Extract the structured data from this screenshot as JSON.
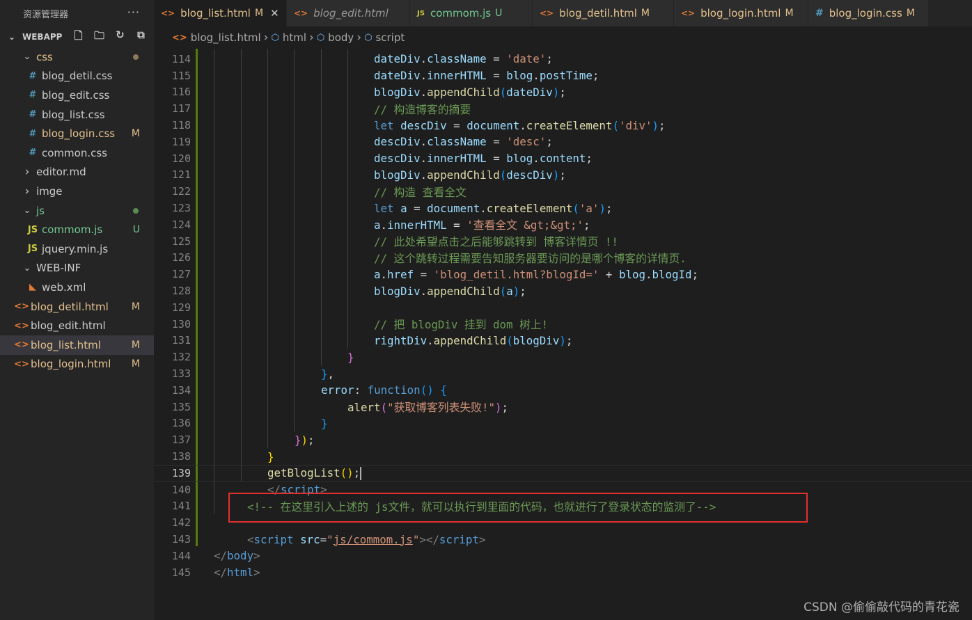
{
  "sidebar": {
    "title": "资源管理器",
    "more": "···",
    "section": "WEBAPP",
    "tree": [
      {
        "label": "css",
        "kind": "folder-open",
        "depth": 1,
        "status": "",
        "dot": "#8a7a5a",
        "color": "#e2c08d"
      },
      {
        "label": "blog_detil.css",
        "kind": "css",
        "depth": 2,
        "status": ""
      },
      {
        "label": "blog_edit.css",
        "kind": "css",
        "depth": 2,
        "status": ""
      },
      {
        "label": "blog_list.css",
        "kind": "css",
        "depth": 2,
        "status": ""
      },
      {
        "label": "blog_login.css",
        "kind": "css",
        "depth": 2,
        "status": "M",
        "color": "#e2c08d"
      },
      {
        "label": "common.css",
        "kind": "css",
        "depth": 2,
        "status": ""
      },
      {
        "label": "editor.md",
        "kind": "folder-closed",
        "depth": 1,
        "status": ""
      },
      {
        "label": "imge",
        "kind": "folder-closed",
        "depth": 1,
        "status": ""
      },
      {
        "label": "js",
        "kind": "folder-open",
        "depth": 1,
        "status": "",
        "dot": "#5e8a56",
        "color": "#73c991"
      },
      {
        "label": "commom.js",
        "kind": "js",
        "depth": 2,
        "status": "U",
        "color": "#73c991"
      },
      {
        "label": "jquery.min.js",
        "kind": "js",
        "depth": 2,
        "status": ""
      },
      {
        "label": "WEB-INF",
        "kind": "folder-open",
        "depth": 1,
        "status": ""
      },
      {
        "label": "web.xml",
        "kind": "xml",
        "depth": 2,
        "status": ""
      },
      {
        "label": "blog_detil.html",
        "kind": "html",
        "depth": 1,
        "status": "M",
        "color": "#e2c08d"
      },
      {
        "label": "blog_edit.html",
        "kind": "html",
        "depth": 1,
        "status": ""
      },
      {
        "label": "blog_list.html",
        "kind": "html",
        "depth": 1,
        "status": "M",
        "color": "#e2c08d",
        "selected": true
      },
      {
        "label": "blog_login.html",
        "kind": "html",
        "depth": 1,
        "status": "M",
        "color": "#e2c08d"
      }
    ]
  },
  "tabs": [
    {
      "label": "blog_list.html",
      "icon": "html",
      "status": "M",
      "active": true,
      "close": "✕"
    },
    {
      "label": "blog_edit.html",
      "icon": "html",
      "status": "",
      "italic": true
    },
    {
      "label": "commom.js",
      "icon": "js",
      "status": "U"
    },
    {
      "label": "blog_detil.html",
      "icon": "html",
      "status": "M"
    },
    {
      "label": "blog_login.html",
      "icon": "html",
      "status": "M"
    },
    {
      "label": "blog_login.css",
      "icon": "css",
      "status": "M"
    }
  ],
  "breadcrumb": [
    "blog_list.html",
    "html",
    "body",
    "script"
  ],
  "editor": {
    "current_line": 139,
    "lines": [
      {
        "n": 114,
        "i": 6,
        "t": [
          [
            "var",
            "dateDiv"
          ],
          [
            "",
            "."
          ],
          [
            "var",
            "className"
          ],
          [
            "",
            " = "
          ],
          [
            "str",
            "'date'"
          ],
          [
            "",
            ";"
          ]
        ]
      },
      {
        "n": 115,
        "i": 6,
        "t": [
          [
            "var",
            "dateDiv"
          ],
          [
            "",
            "."
          ],
          [
            "var",
            "innerHTML"
          ],
          [
            "",
            " = "
          ],
          [
            "var",
            "blog"
          ],
          [
            "",
            "."
          ],
          [
            "var",
            "postTime"
          ],
          [
            "",
            ";"
          ]
        ]
      },
      {
        "n": 116,
        "i": 6,
        "t": [
          [
            "var",
            "blogDiv"
          ],
          [
            "",
            "."
          ],
          [
            "fn",
            "appendChild"
          ],
          [
            "b3",
            "("
          ],
          [
            "var",
            "dateDiv"
          ],
          [
            "b3",
            ")"
          ],
          [
            "",
            ";"
          ]
        ]
      },
      {
        "n": 117,
        "i": 6,
        "t": [
          [
            "cm",
            "// 构造博客的摘要"
          ]
        ]
      },
      {
        "n": 118,
        "i": 6,
        "t": [
          [
            "kw",
            "let"
          ],
          [
            "",
            " "
          ],
          [
            "var",
            "descDiv"
          ],
          [
            "",
            " = "
          ],
          [
            "var",
            "document"
          ],
          [
            "",
            "."
          ],
          [
            "fn",
            "createElement"
          ],
          [
            "b3",
            "("
          ],
          [
            "str",
            "'div'"
          ],
          [
            "b3",
            ")"
          ],
          [
            "",
            ";"
          ]
        ]
      },
      {
        "n": 119,
        "i": 6,
        "t": [
          [
            "var",
            "descDiv"
          ],
          [
            "",
            "."
          ],
          [
            "var",
            "className"
          ],
          [
            "",
            " = "
          ],
          [
            "str",
            "'desc'"
          ],
          [
            "",
            ";"
          ]
        ]
      },
      {
        "n": 120,
        "i": 6,
        "t": [
          [
            "var",
            "descDiv"
          ],
          [
            "",
            "."
          ],
          [
            "var",
            "innerHTML"
          ],
          [
            "",
            " = "
          ],
          [
            "var",
            "blog"
          ],
          [
            "",
            "."
          ],
          [
            "var",
            "content"
          ],
          [
            "",
            ";"
          ]
        ]
      },
      {
        "n": 121,
        "i": 6,
        "t": [
          [
            "var",
            "blogDiv"
          ],
          [
            "",
            "."
          ],
          [
            "fn",
            "appendChild"
          ],
          [
            "b3",
            "("
          ],
          [
            "var",
            "descDiv"
          ],
          [
            "b3",
            ")"
          ],
          [
            "",
            ";"
          ]
        ]
      },
      {
        "n": 122,
        "i": 6,
        "t": [
          [
            "cm",
            "// 构造 查看全文"
          ]
        ]
      },
      {
        "n": 123,
        "i": 6,
        "t": [
          [
            "kw",
            "let"
          ],
          [
            "",
            " "
          ],
          [
            "var",
            "a"
          ],
          [
            "",
            " = "
          ],
          [
            "var",
            "document"
          ],
          [
            "",
            "."
          ],
          [
            "fn",
            "createElement"
          ],
          [
            "b3",
            "("
          ],
          [
            "str",
            "'a'"
          ],
          [
            "b3",
            ")"
          ],
          [
            "",
            ";"
          ]
        ]
      },
      {
        "n": 124,
        "i": 6,
        "t": [
          [
            "var",
            "a"
          ],
          [
            "",
            "."
          ],
          [
            "var",
            "innerHTML"
          ],
          [
            "",
            " = "
          ],
          [
            "str",
            "'查看全文 &gt;&gt;'"
          ],
          [
            "",
            ";"
          ]
        ]
      },
      {
        "n": 125,
        "i": 6,
        "t": [
          [
            "cm",
            "// 此处希望点击之后能够跳转到 博客详情页 !!"
          ]
        ]
      },
      {
        "n": 126,
        "i": 6,
        "t": [
          [
            "cm",
            "// 这个跳转过程需要告知服务器要访问的是哪个博客的详情页."
          ]
        ]
      },
      {
        "n": 127,
        "i": 6,
        "t": [
          [
            "var",
            "a"
          ],
          [
            "",
            "."
          ],
          [
            "var",
            "href"
          ],
          [
            "",
            " = "
          ],
          [
            "str",
            "'blog_detil.html?blogId='"
          ],
          [
            "",
            " + "
          ],
          [
            "var",
            "blog"
          ],
          [
            "",
            "."
          ],
          [
            "var",
            "blogId"
          ],
          [
            "",
            ";"
          ]
        ]
      },
      {
        "n": 128,
        "i": 6,
        "t": [
          [
            "var",
            "blogDiv"
          ],
          [
            "",
            "."
          ],
          [
            "fn",
            "appendChild"
          ],
          [
            "b3",
            "("
          ],
          [
            "var",
            "a"
          ],
          [
            "b3",
            ")"
          ],
          [
            "",
            ";"
          ]
        ]
      },
      {
        "n": 129,
        "i": 0,
        "t": []
      },
      {
        "n": 130,
        "i": 6,
        "t": [
          [
            "cm",
            "// 把 blogDiv 挂到 dom 树上!"
          ]
        ]
      },
      {
        "n": 131,
        "i": 6,
        "t": [
          [
            "var",
            "rightDiv"
          ],
          [
            "",
            "."
          ],
          [
            "fn",
            "appendChild"
          ],
          [
            "b3",
            "("
          ],
          [
            "var",
            "blogDiv"
          ],
          [
            "b3",
            ")"
          ],
          [
            "",
            ";"
          ]
        ]
      },
      {
        "n": 132,
        "i": 5,
        "t": [
          [
            "b2",
            "}"
          ]
        ]
      },
      {
        "n": 133,
        "i": 4,
        "t": [
          [
            "b3",
            "}"
          ],
          [
            "",
            ","
          ]
        ]
      },
      {
        "n": 134,
        "i": 4,
        "t": [
          [
            "var",
            "error"
          ],
          [
            "",
            ": "
          ],
          [
            "kw",
            "function"
          ],
          [
            "b3",
            "()"
          ],
          [
            "",
            " "
          ],
          [
            "b3",
            "{"
          ]
        ]
      },
      {
        "n": 135,
        "i": 5,
        "t": [
          [
            "fn",
            "alert"
          ],
          [
            "b2",
            "("
          ],
          [
            "str",
            "\"获取博客列表失败!\""
          ],
          [
            "b2",
            ")"
          ],
          [
            "",
            ";"
          ]
        ]
      },
      {
        "n": 136,
        "i": 4,
        "t": [
          [
            "b3",
            "}"
          ]
        ]
      },
      {
        "n": 137,
        "i": 3,
        "t": [
          [
            "b2",
            "}"
          ],
          [
            "b1",
            ")"
          ],
          [
            "",
            ";"
          ]
        ]
      },
      {
        "n": 138,
        "i": 2,
        "t": [
          [
            "b1",
            "}"
          ]
        ]
      },
      {
        "n": 139,
        "i": 2,
        "t": [
          [
            "fn",
            "getBlogList"
          ],
          [
            "b1",
            "()"
          ],
          [
            "",
            ";"
          ]
        ],
        "cursor": true
      },
      {
        "n": 140,
        "i": 2,
        "t": [
          [
            "punct",
            "</"
          ],
          [
            "tag",
            "script"
          ],
          [
            "punct",
            ">"
          ]
        ]
      },
      {
        "n": 141,
        "i": 1,
        "t": [
          [
            "cm",
            "<!-- 在这里引入上述的 js文件，就可以执行到里面的代码，也就进行了登录状态的监测了-->"
          ]
        ]
      },
      {
        "n": 142,
        "i": 0,
        "t": []
      },
      {
        "n": 143,
        "i": 1,
        "t": [
          [
            "punct",
            "<"
          ],
          [
            "tag",
            "script"
          ],
          [
            "",
            " "
          ],
          [
            "attr",
            "src"
          ],
          [
            "",
            "="
          ],
          [
            "str",
            "\""
          ],
          [
            "strlink",
            "js/commom.js"
          ],
          [
            "str",
            "\""
          ],
          [
            "punct",
            "></"
          ],
          [
            "tag",
            "script"
          ],
          [
            "punct",
            ">"
          ]
        ]
      },
      {
        "n": 144,
        "i": 0,
        "t": [
          [
            "punct",
            "</"
          ],
          [
            "tag",
            "body"
          ],
          [
            "punct",
            ">"
          ]
        ]
      },
      {
        "n": 145,
        "i": 0,
        "t": [
          [
            "punct",
            "</"
          ],
          [
            "tag",
            "html"
          ],
          [
            "punct",
            ">"
          ]
        ]
      }
    ]
  },
  "watermark": "CSDN @偷偷敲代码的青花瓷",
  "colors": {
    "modified": "#e2c08d",
    "untracked": "#73c991",
    "highlight_box": "#e0302f",
    "accent_git_bar": "#587c0c"
  }
}
